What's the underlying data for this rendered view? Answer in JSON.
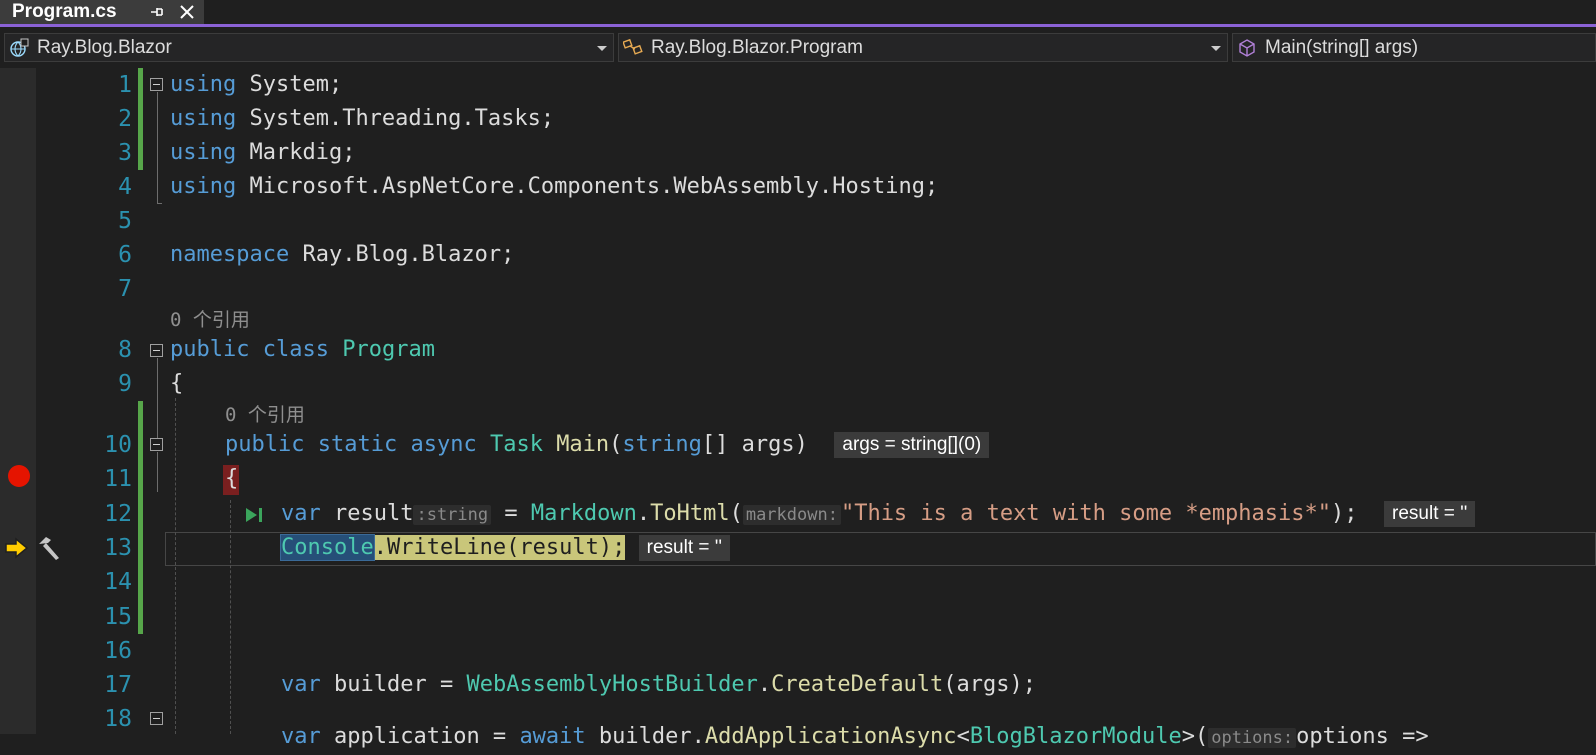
{
  "tab": {
    "title": "Program.cs"
  },
  "navbar": {
    "project": "Ray.Blog.Blazor",
    "type": "Ray.Blog.Blazor.Program",
    "member": "Main(string[] args)"
  },
  "icons": {
    "tab": [
      "pin-icon",
      "close-icon"
    ],
    "navbar": [
      "csharp-project-icon",
      "class-icon",
      "method-icon"
    ],
    "margin": [
      "breakpoint-icon",
      "current-statement-arrow-icon",
      "hammer-icon",
      "run-to-click-icon"
    ]
  },
  "colors": {
    "accent": "#8b62d6",
    "keyword": "#569cd6",
    "type": "#4ec9b0",
    "method": "#dcdcaa",
    "string": "#d69d85",
    "line_number": "#2b91af",
    "breakpoint": "#e51400",
    "changed_line": "#57a64a",
    "current_statement": "#c9c67a"
  },
  "code": {
    "line_numbers": [
      "1",
      "2",
      "3",
      "4",
      "5",
      "6",
      "7",
      "8",
      "9",
      "10",
      "11",
      "12",
      "13",
      "14",
      "15",
      "16",
      "17",
      "18"
    ],
    "codelens": [
      "0 个引用",
      "0 个引用"
    ],
    "l1": {
      "kw": "using",
      "rest": " System;"
    },
    "l2": {
      "kw": "using",
      "rest": " System.Threading.Tasks;"
    },
    "l3": {
      "kw": "using",
      "rest": " Markdig;"
    },
    "l4": {
      "kw": "using",
      "rest": " Microsoft.AspNetCore.Components.WebAssembly.Hosting;"
    },
    "l6": {
      "kw": "namespace",
      "rest": " Ray.Blog.Blazor;"
    },
    "l8": {
      "kw1": "public",
      "kw2": "class",
      "type": "Program"
    },
    "l9": {
      "text": "{"
    },
    "l10": {
      "kw1": "public",
      "kw2": "static",
      "kw3": "async",
      "type": "Task",
      "method": "Main",
      "p1": "(",
      "kw4": "string",
      "p2": "[] args)",
      "datatip": "args = string[](0)"
    },
    "l11": {
      "text": "{"
    },
    "l12": {
      "kw": "var",
      "name": " result",
      "hint1": ":string",
      "eq": " = ",
      "type": "Markdown",
      "dot": ".",
      "method": "ToHtml",
      "p1": "(",
      "hint2": "markdown:",
      "str": "\"This is a text with some *emphasis*\"",
      "p2": ");",
      "datatip": "result = ''"
    },
    "l13": {
      "type": "Console",
      "dot": ".",
      "method": "WriteLine",
      "args": "(result);",
      "datatip": "result = ''"
    },
    "l16": {
      "kw": "var",
      "name": " builder = ",
      "type": "WebAssemblyHostBuilder",
      "dot": ".",
      "method": "CreateDefault",
      "args": "(args);"
    },
    "l18": {
      "kw1": "var",
      "name": " application = ",
      "kw2": "await",
      "mid": " builder.",
      "method": "AddApplicationAsync",
      "lt": "<",
      "type": "BlogBlazorModule",
      "gt": ">(",
      "hint": "options:",
      "tail": "options =>"
    }
  }
}
